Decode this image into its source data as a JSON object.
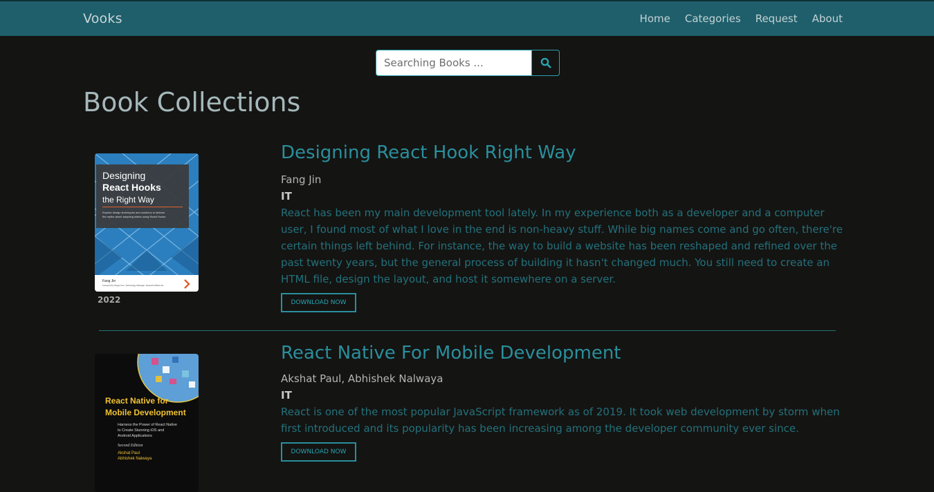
{
  "nav": {
    "brand": "Vooks",
    "links": [
      "Home",
      "Categories",
      "Request",
      "About"
    ]
  },
  "search": {
    "placeholder": "Searching Books ...",
    "value": "",
    "icon": "search-icon"
  },
  "page_title": "Book Collections",
  "books": [
    {
      "title": "Designing React Hook Right Way",
      "author": "Fang Jin",
      "category": "IT",
      "description": "React has been my main development tool lately. In my experience both as a developer and a computer user, I found most of what I love in the end is non-heavy stuff. While big names come and go often, there're certain things left behind. For instance, the way to build a website has been reshaped and refined over the past twenty years, but the general process of building it hasn't changed much. You still need to create an HTML file, design the layout, and host it somewhere on a server.",
      "year": "2022",
      "button": "DOWNLOAD NOW",
      "cover": {
        "line1": "Designing",
        "line2": "React Hooks",
        "line3": "the Right Way",
        "blurb1": "Explore design techniques and solutions to debunk",
        "blurb2": "the myths about adopting states using React Hooks",
        "author": "Fang Jin",
        "foreword": "Foreword by Roger Ken, Technology Manager, Deutsche Bank AG"
      }
    },
    {
      "title": "React Native For Mobile Development",
      "author": "Akshat Paul, Abhishek Nalwaya",
      "category": "IT",
      "description": "React is one of the most popular JavaScript framework as of 2019. It took web development by storm when first introduced and its popularity has been increasing among the developer community ever since.",
      "button": "DOWNLOAD NOW",
      "cover": {
        "line1": "React Native for",
        "line2": "Mobile Development",
        "sub1": "Harness the Power of React Native",
        "sub2": "to Create Stunning iOS and",
        "sub3": "Android Applications",
        "edition": "Second Edition",
        "author1": "Akshat Paul",
        "author2": "Abhishek Nalwaya"
      }
    }
  ],
  "colors": {
    "navbar": "#1f5f6b",
    "background": "#141412",
    "accent": "#2a8f9d"
  }
}
